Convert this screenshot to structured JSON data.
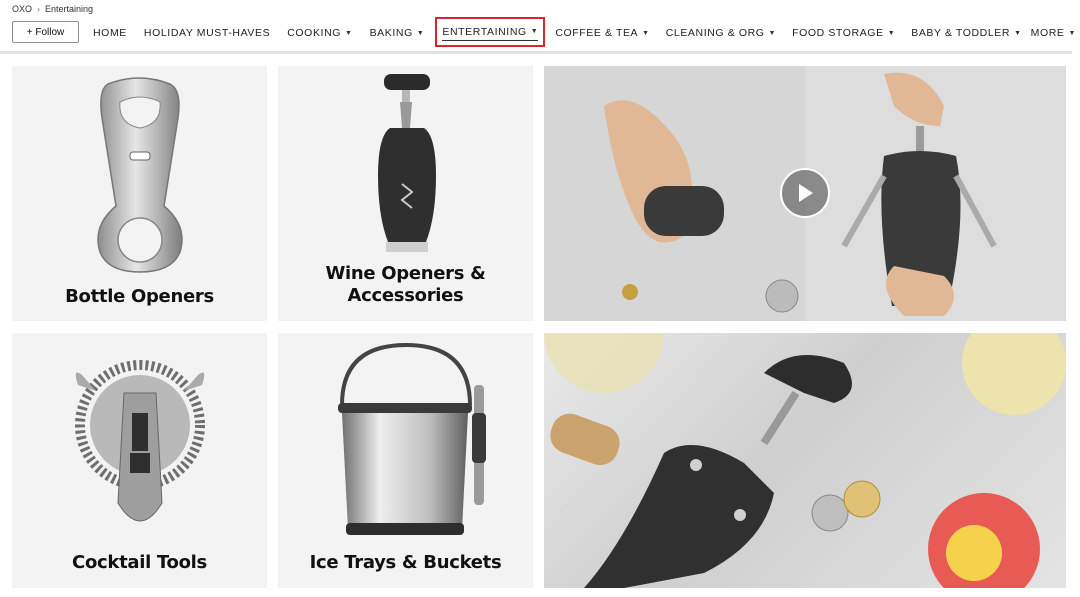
{
  "breadcrumb": {
    "store": "OXO",
    "current": "Entertaining"
  },
  "follow_label": "+ Follow",
  "nav": [
    {
      "label": "HOME",
      "dropdown": false
    },
    {
      "label": "HOLIDAY MUST-HAVES",
      "dropdown": false
    },
    {
      "label": "COOKING",
      "dropdown": true
    },
    {
      "label": "BAKING",
      "dropdown": true
    },
    {
      "label": "ENTERTAINING",
      "dropdown": true,
      "active": true
    },
    {
      "label": "COFFEE & TEA",
      "dropdown": true
    },
    {
      "label": "CLEANING & ORG",
      "dropdown": true
    },
    {
      "label": "FOOD STORAGE",
      "dropdown": true
    },
    {
      "label": "BABY & TODDLER",
      "dropdown": true
    },
    {
      "label": "MORE",
      "dropdown": true
    }
  ],
  "tiles": {
    "bottle_openers": "Bottle Openers",
    "wine_openers_line1": "Wine Openers &",
    "wine_openers_line2": "Accessories",
    "cocktail_tools": "Cocktail Tools",
    "ice_trays": "Ice Trays & Buckets"
  },
  "colors": {
    "active_outline": "#d9262c",
    "divider": "#e3e3e3"
  },
  "icons": {
    "breadcrumb_sep": "chevron-right-icon",
    "caret": "caret-down-icon",
    "play": "play-icon"
  }
}
